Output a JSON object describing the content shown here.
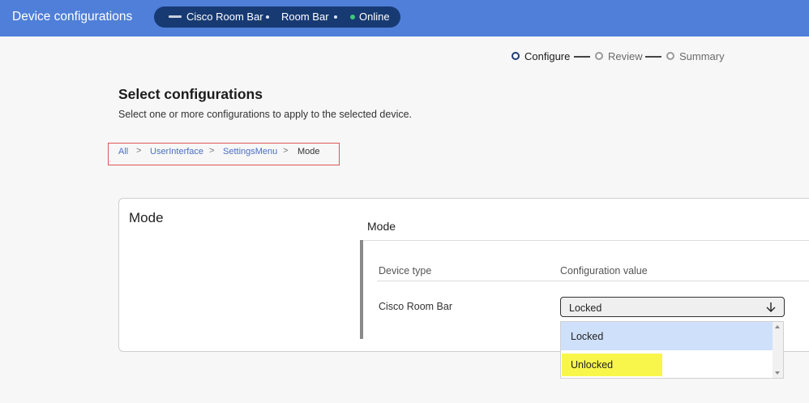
{
  "header": {
    "title": "Device configurations",
    "device_name": "Cisco Room Bar",
    "device_model": "Room Bar",
    "status": "Online",
    "status_color": "#3fc77a"
  },
  "stepper": {
    "steps": [
      {
        "label": "Configure",
        "active": true
      },
      {
        "label": "Review",
        "active": false
      },
      {
        "label": "Summary",
        "active": false
      }
    ]
  },
  "page": {
    "heading": "Select configurations",
    "subheading": "Select one or more configurations to apply to the selected device."
  },
  "breadcrumb": {
    "items": [
      "All",
      "UserInterface",
      "SettingsMenu",
      "Mode"
    ],
    "separator": ">"
  },
  "card": {
    "title": "Mode",
    "panel_title": "Mode",
    "columns": [
      "Device type",
      "Configuration value"
    ],
    "row": {
      "device": "Cisco Room Bar",
      "selected_value": "Locked"
    },
    "dropdown_options": [
      "Locked",
      "Unlocked"
    ]
  }
}
